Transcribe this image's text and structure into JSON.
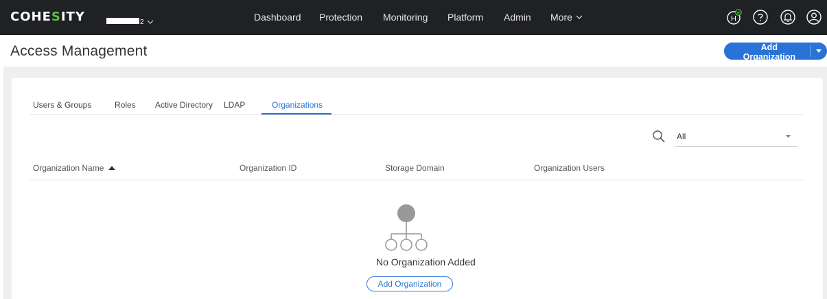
{
  "topbar": {
    "logo_main_1": "COHE",
    "logo_accent": "S",
    "logo_main_2": "ITY",
    "cluster_suffix": "2",
    "nav": [
      "Dashboard",
      "Protection",
      "Monitoring",
      "Platform",
      "Admin",
      "More"
    ],
    "icons": [
      "health-icon",
      "help-icon",
      "notifications-icon",
      "user-profile-icon"
    ],
    "health_badge_label": "H"
  },
  "header": {
    "title": "Access Management",
    "add_button_label": "Add Organization"
  },
  "tabs": [
    "Users & Groups",
    "Roles",
    "Active Directory",
    "LDAP",
    "Organizations"
  ],
  "active_tab": "Organizations",
  "filter": {
    "value": "All"
  },
  "table": {
    "columns": [
      "Organization Name",
      "Organization ID",
      "Storage Domain",
      "Organization Users"
    ],
    "sort_column": "Organization Name",
    "sort_direction": "ascending",
    "rows": []
  },
  "empty_state": {
    "message": "No Organization Added",
    "button_label": "Add Organization"
  },
  "colors": {
    "topbar": "#1f2125",
    "accent": "#2873d7",
    "logo_accent": "#5bc236",
    "content_bg": "#efefef"
  }
}
